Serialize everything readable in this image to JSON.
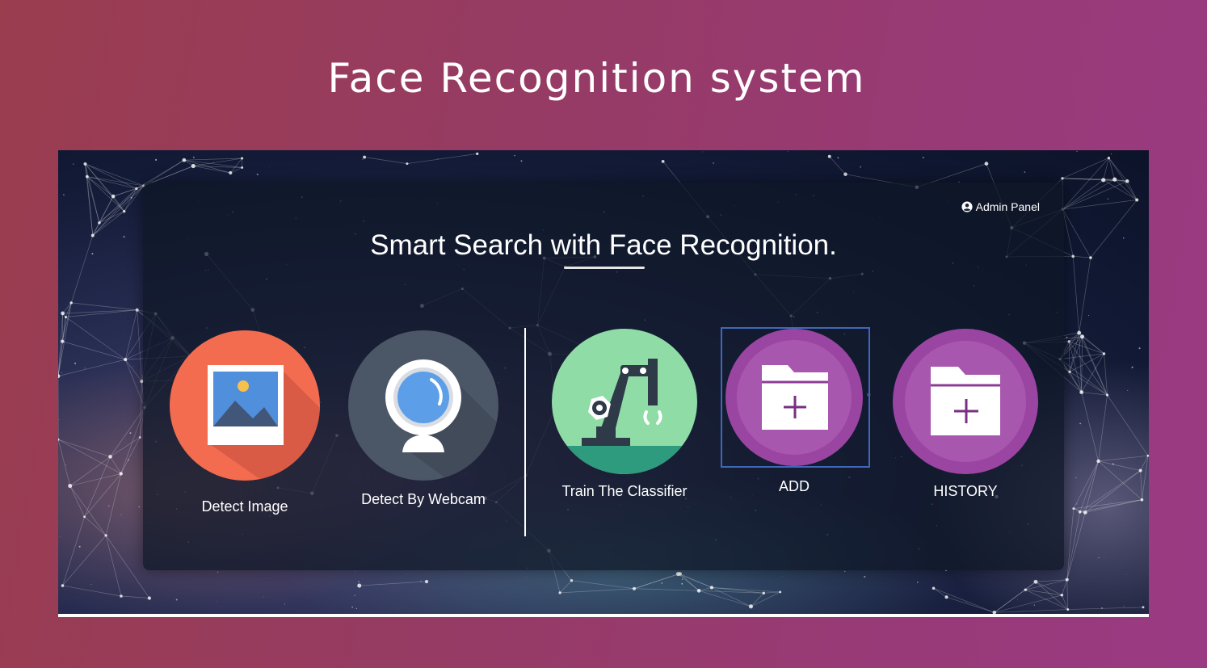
{
  "page": {
    "title": "Face Recognition system"
  },
  "panel": {
    "admin_label": "Admin Panel",
    "heading": "Smart Search with Face Recognition."
  },
  "tiles": [
    {
      "label": "Detect Image",
      "icon": "image-icon",
      "color": "#f36c4f"
    },
    {
      "label": "Detect By Webcam",
      "icon": "webcam-icon",
      "color": "#4b5666"
    },
    {
      "label": "Train The Classifier",
      "icon": "robot-arm-icon",
      "color": "#8fdca6"
    },
    {
      "label": "ADD",
      "icon": "add-folder-icon",
      "color": "#9b45a3"
    },
    {
      "label": "HISTORY",
      "icon": "add-folder-icon",
      "color": "#9b45a3"
    }
  ],
  "colors": {
    "background_start": "#9a3d4f",
    "background_end": "#9a3a83",
    "panel": "#0e1626",
    "selection_frame": "#3f68b8"
  }
}
